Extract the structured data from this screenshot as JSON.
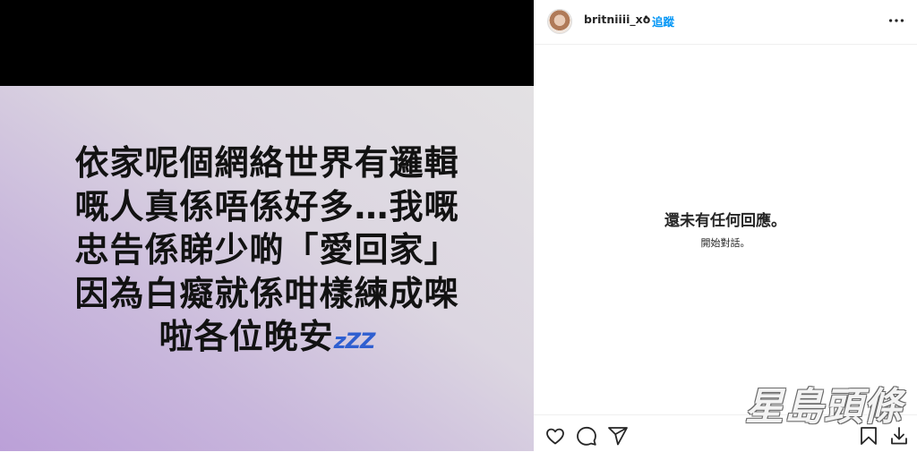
{
  "story": {
    "lines": [
      "依家呢個網絡世界有邏輯",
      "嘅人真係唔係好多…我嘅",
      "忠告係睇少啲「愛回家」",
      "因為白癡就係咁樣練成㗎",
      "啦各位晚安"
    ],
    "zzz": "zZZ"
  },
  "header": {
    "username": "britniiii_xo",
    "separator": "•",
    "follow_label": "追蹤"
  },
  "comments": {
    "empty_title": "還未有任何回應。",
    "empty_subtitle": "開始對話。"
  },
  "watermark": "星島頭條",
  "colors": {
    "follow_blue": "#0095f6",
    "zzz_blue": "#2f5fd0"
  },
  "icons": [
    "heart-icon",
    "comment-icon",
    "share-icon",
    "bookmark-icon",
    "download-icon",
    "more-options-icon"
  ]
}
